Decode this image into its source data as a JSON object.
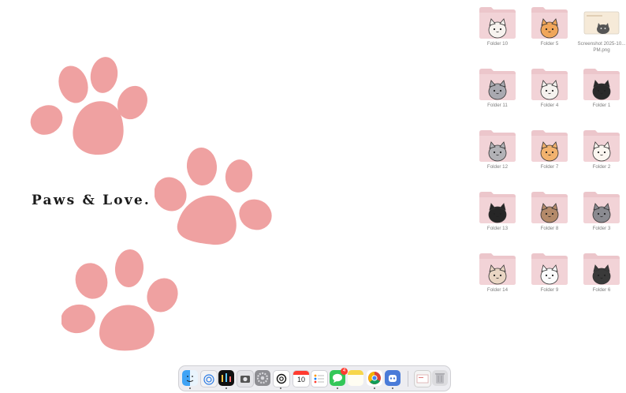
{
  "wallpaper": {
    "title": "Paws & Love.",
    "paw_color": "#efa1a1"
  },
  "desktop": {
    "icons": [
      {
        "label": "Folder 10",
        "kind": "folder",
        "cat": "white-peek"
      },
      {
        "label": "Folder 5",
        "kind": "folder",
        "cat": "orange"
      },
      {
        "label": "Screenshot 2025-10... PM.png",
        "kind": "screenshot"
      },
      {
        "label": "Folder 11",
        "kind": "folder",
        "cat": "grey"
      },
      {
        "label": "Folder 4",
        "kind": "folder",
        "cat": "white-side"
      },
      {
        "label": "Folder 1",
        "kind": "folder",
        "cat": "black"
      },
      {
        "label": "Folder 12",
        "kind": "folder",
        "cat": "grey-flower"
      },
      {
        "label": "Folder 7",
        "kind": "folder",
        "cat": "orange-book"
      },
      {
        "label": "Folder 2",
        "kind": "folder",
        "cat": "calico"
      },
      {
        "label": "Folder 13",
        "kind": "folder",
        "cat": "black-hang"
      },
      {
        "label": "Folder 8",
        "kind": "folder",
        "cat": "brown"
      },
      {
        "label": "Folder 3",
        "kind": "folder",
        "cat": "grey-side"
      },
      {
        "label": "Folder 14",
        "kind": "folder",
        "cat": "calico-sit"
      },
      {
        "label": "Folder 9",
        "kind": "folder",
        "cat": "white"
      },
      {
        "label": "Folder 6",
        "kind": "folder",
        "cat": "black-peek"
      }
    ]
  },
  "dock": {
    "apps": [
      {
        "name": "Finder",
        "icon": "finder-icon",
        "running": true
      },
      {
        "name": "AirDrop",
        "icon": "airdrop-icon",
        "running": false
      },
      {
        "name": "Equalizer",
        "icon": "equalizer-icon",
        "running": true
      },
      {
        "name": "Screenshot",
        "icon": "camera-icon",
        "running": false
      },
      {
        "name": "System Settings",
        "icon": "gear-icon",
        "running": false
      },
      {
        "name": "ChatGPT",
        "icon": "chatgpt-icon",
        "running": true
      },
      {
        "name": "Calendar",
        "icon": "calendar-icon",
        "running": false,
        "day": "10"
      },
      {
        "name": "Reminders",
        "icon": "reminders-icon",
        "running": false
      },
      {
        "name": "Messages",
        "icon": "messages-icon",
        "running": true,
        "badge": "4"
      },
      {
        "name": "Notes",
        "icon": "notes-icon",
        "running": false
      },
      {
        "name": "Chrome",
        "icon": "chrome-icon",
        "running": true
      },
      {
        "name": "Assistant",
        "icon": "robot-icon",
        "running": true
      },
      {
        "name": "Screenshot file",
        "icon": "screenshot-stack-icon",
        "running": false
      },
      {
        "name": "Trash",
        "icon": "trash-icon",
        "running": false
      }
    ]
  }
}
